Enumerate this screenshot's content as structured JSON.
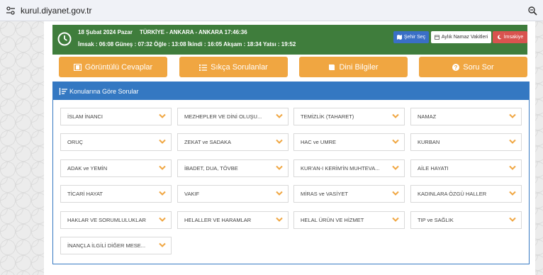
{
  "browser": {
    "url": "kurul.diyanet.gov.tr"
  },
  "prayer": {
    "date": "18 Şubat 2024 Pazar",
    "location_time": "TÜRKİYE - ANKARA - ANKARA 17:46:36",
    "times": "İmsak : 06:08 Güneş : 07:32 Öğle : 13:08 İkindi : 16:05 Akşam : 18:34 Yatsı : 19:52"
  },
  "bar_buttons": {
    "city": "Şehir Seç",
    "monthly": "Aylık Namaz Vakitleri",
    "imsakiye": "İmsakiye"
  },
  "main_buttons": [
    "Görüntülü Cevaplar",
    "Sıkça Sorulanlar",
    "Dini Bilgiler",
    "Soru Sor"
  ],
  "panel": {
    "title": "Konularına Göre Sorular"
  },
  "topics": [
    "İSLAM İNANCI",
    "MEZHEPLER VE DİNİ OLUŞU...",
    "TEMİZLİK (TAHARET)",
    "NAMAZ",
    "ORUÇ",
    "ZEKAT ve SADAKA",
    "HAC ve UMRE",
    "KURBAN",
    "ADAK ve YEMİN",
    "İBADET, DUA, TÖVBE",
    "KUR'AN-I KERİM'İN MUHTEVA...",
    "AİLE HAYATI",
    "TİCARİ HAYAT",
    "VAKIF",
    "MİRAS ve VASİYET",
    "KADINLARA ÖZGÜ HALLER",
    "HAKLAR VE SORUMLULUKLAR",
    "HELALLER VE HARAMLAR",
    "HELAL ÜRÜN VE HİZMET",
    "TIP ve SAĞLIK",
    "İNANÇLA İLGİLİ DİĞER MESE..."
  ],
  "colors": {
    "green": "#3f7d3c",
    "orange": "#f0a641",
    "blue": "#3478c2",
    "red": "#d9534f",
    "chevron": "#f0a641"
  }
}
